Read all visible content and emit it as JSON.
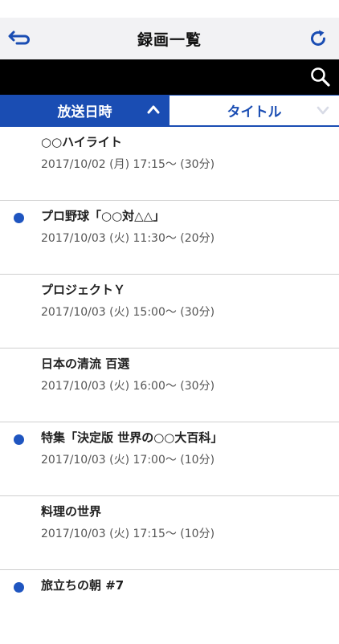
{
  "header": {
    "title": "録画一覧"
  },
  "tabs": [
    {
      "label": "放送日時",
      "active": true
    },
    {
      "label": "タイトル",
      "active": false
    }
  ],
  "recordings": [
    {
      "title": "○○ハイライト",
      "datetime": "2017/10/02 (月) 17:15〜 (30分)",
      "unwatched": false
    },
    {
      "title": "プロ野球「○○対△△」",
      "datetime": "2017/10/03 (火) 11:30〜 (20分)",
      "unwatched": true
    },
    {
      "title": "プロジェクトＹ",
      "datetime": "2017/10/03 (火) 15:00〜 (30分)",
      "unwatched": false
    },
    {
      "title": "日本の清流 百選",
      "datetime": "2017/10/03 (火) 16:00〜 (30分)",
      "unwatched": false
    },
    {
      "title": "特集「決定版 世界の○○大百科」",
      "datetime": "2017/10/03 (火) 17:00〜 (10分)",
      "unwatched": true
    },
    {
      "title": "料理の世界",
      "datetime": "2017/10/03 (火) 17:15〜 (10分)",
      "unwatched": false
    },
    {
      "title": "旅立ちの朝 #7",
      "datetime": "",
      "unwatched": true
    }
  ],
  "colors": {
    "accent": "#1a4db3",
    "dot": "#1f55c0"
  }
}
